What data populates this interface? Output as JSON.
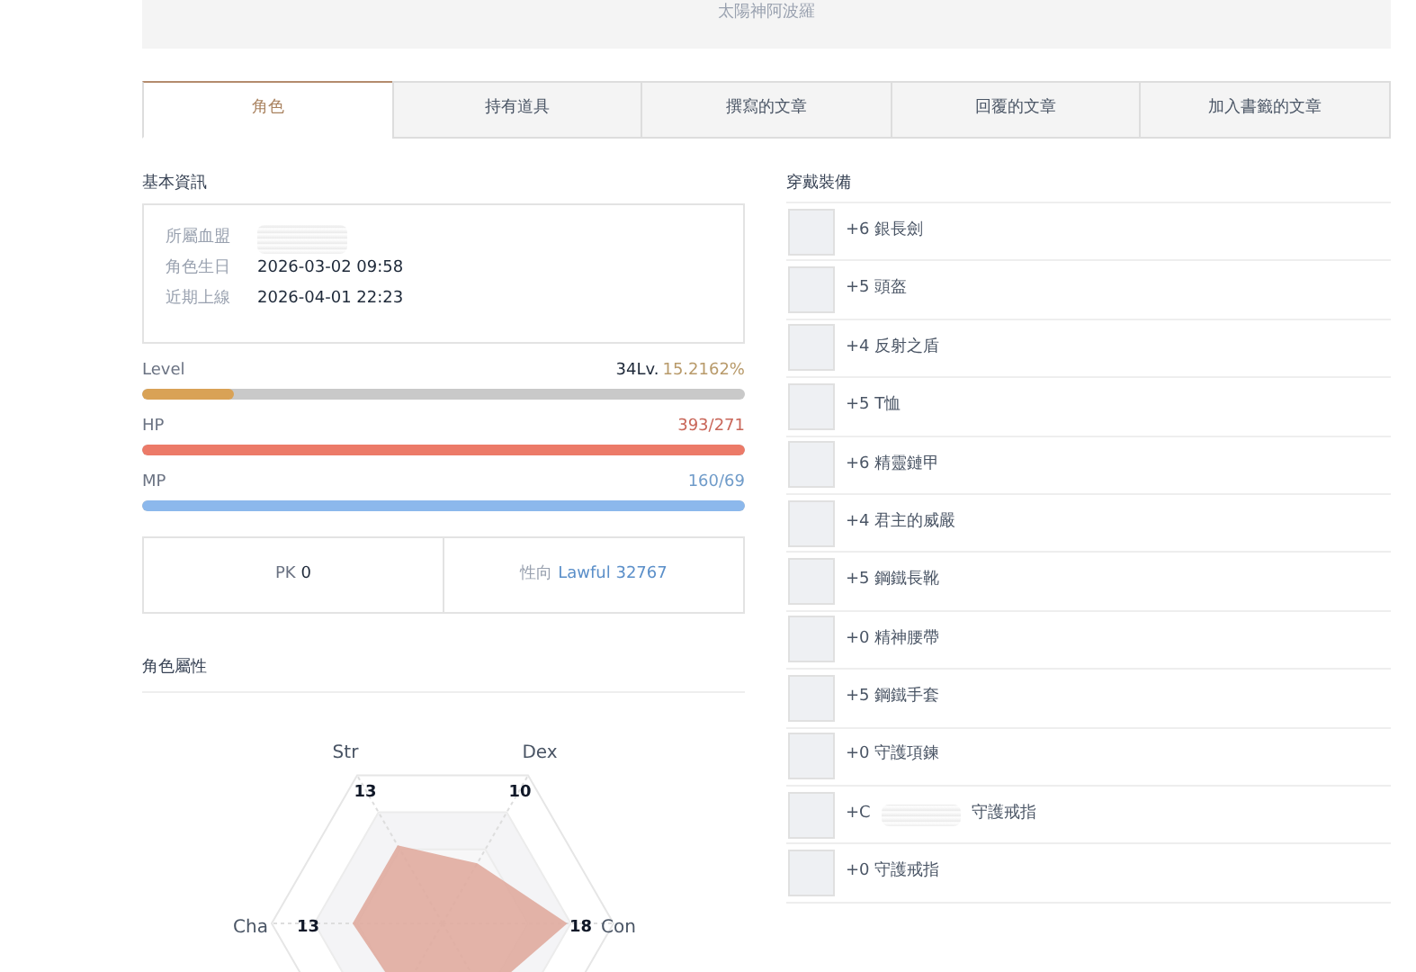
{
  "banner": {
    "text": "太陽神阿波羅"
  },
  "tabs": [
    {
      "label": "角色",
      "selected": true
    },
    {
      "label": "持有道具",
      "selected": false
    },
    {
      "label": "撰寫的文章",
      "selected": false
    },
    {
      "label": "回覆的文章",
      "selected": false
    },
    {
      "label": "加入書籤的文章",
      "selected": false
    }
  ],
  "basic_info": {
    "title": "基本資訊",
    "rows": [
      {
        "label": "所屬血盟",
        "redacted": true
      },
      {
        "label": "角色生日",
        "value": "2026-03-02 09:58"
      },
      {
        "label": "近期上線",
        "value": "2026-04-01 22:23"
      }
    ]
  },
  "meters": [
    {
      "kind": "level",
      "label": "Level",
      "reading_strong": "34Lv.",
      "reading": "15.2162%",
      "level": 0.152
    },
    {
      "kind": "hp",
      "label": "HP",
      "reading": "393/271",
      "level": 1
    },
    {
      "kind": "mp",
      "label": "MP",
      "reading": "160/69",
      "level": 1
    }
  ],
  "pk": {
    "label": "PK",
    "value": "0"
  },
  "alignment": {
    "label": "性向",
    "value": "Lawful 32767"
  },
  "attributes": {
    "title": "角色屬性",
    "stats": [
      {
        "label": "Str",
        "value": "13"
      },
      {
        "label": "Dex",
        "value": "10"
      },
      {
        "label": "Con",
        "value": "18"
      },
      {
        "label": "Cha",
        "value": "13"
      }
    ]
  },
  "equipment": {
    "title": "穿戴裝備",
    "items": [
      {
        "name": "+6 銀長劍"
      },
      {
        "name": "+5 頭盔"
      },
      {
        "name": "+4 反射之盾"
      },
      {
        "name": "+5 T恤"
      },
      {
        "name": "+6 精靈鏈甲"
      },
      {
        "name": "+4 君主的威嚴"
      },
      {
        "name": "+5 鋼鐵長靴"
      },
      {
        "name": "+0 精神腰帶"
      },
      {
        "name": "+5 鋼鐵手套"
      },
      {
        "name": "+0 守護項鍊"
      },
      {
        "name": "+C",
        "redacted": true,
        "name_after": "守護戒指"
      },
      {
        "name": "+0 守護戒指"
      }
    ]
  }
}
